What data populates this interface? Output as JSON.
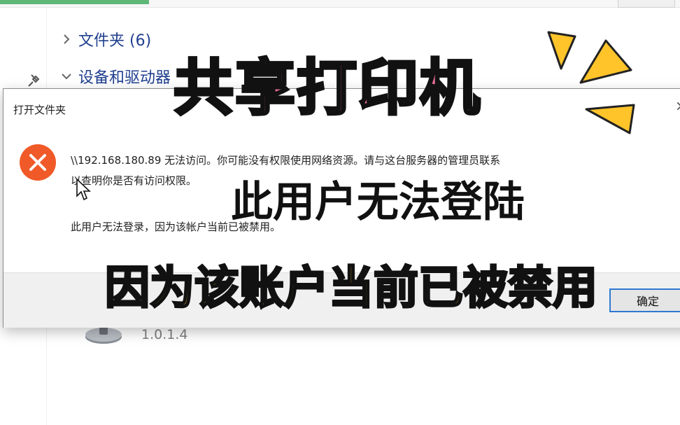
{
  "explorer": {
    "sections": {
      "folders": "文件夹 (6)",
      "devices": "设备和驱动器"
    },
    "drive_label": "1.0.1.4"
  },
  "dialog": {
    "title": "打开文件夹",
    "close_glyph": "×",
    "message_line1": "\\\\192.168.180.89 无法访问。你可能没有权限使用网络资源。请与这台服务器的管理员联系",
    "message_line2": "以查明你是否有访问权限。",
    "message_detail": "此用户无法登录，因为该帐户当前已被禁用。",
    "ok_label": "确定"
  },
  "overlay": {
    "title": "共享打印机",
    "subtitle": "此用户无法登陆",
    "reason": "因为该账户当前已被禁用"
  },
  "colors": {
    "error_red": "#f05a28",
    "caption_pink": "#f06e9a",
    "caption_yellow": "#ffc42a",
    "accent_blue": "#2f78d3"
  }
}
